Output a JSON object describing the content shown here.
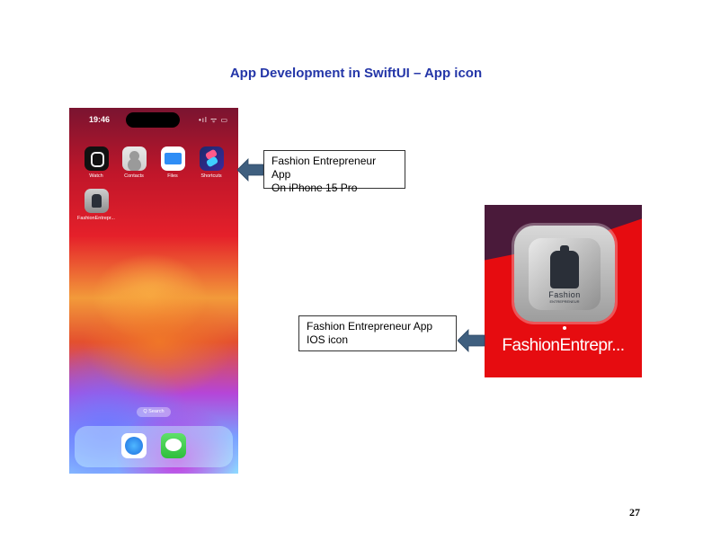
{
  "slide": {
    "title": "App Development in SwiftUI – App icon",
    "page_number": "27"
  },
  "phone": {
    "time": "19:46",
    "status": "•ıl ᯤ ▭",
    "apps": [
      {
        "label": "Watch",
        "icon": "watch-icon"
      },
      {
        "label": "Contacts",
        "icon": "contacts-icon"
      },
      {
        "label": "Files",
        "icon": "folder-icon"
      },
      {
        "label": "Shortcuts",
        "icon": "shortcuts-icon"
      },
      {
        "label": "FashionEntrepr...",
        "icon": "fashion-app-icon"
      }
    ],
    "search": "Q Search",
    "dock": [
      {
        "icon": "safari-icon"
      },
      {
        "icon": "messages-icon"
      }
    ]
  },
  "callouts": {
    "phone_line1": "Fashion Entrepreneur App",
    "phone_line2": "On iPhone 15 Pro",
    "icon_line1": "Fashion Entrepreneur App",
    "icon_line2": "IOS icon"
  },
  "big_icon": {
    "logo_text": "Fashion",
    "logo_sub": "ENTREPRENEUR",
    "label": "FashionEntrepr..."
  },
  "colors": {
    "title": "#2436a8",
    "arrow": "#3f5f7f",
    "icon_background": "#e60c10"
  }
}
